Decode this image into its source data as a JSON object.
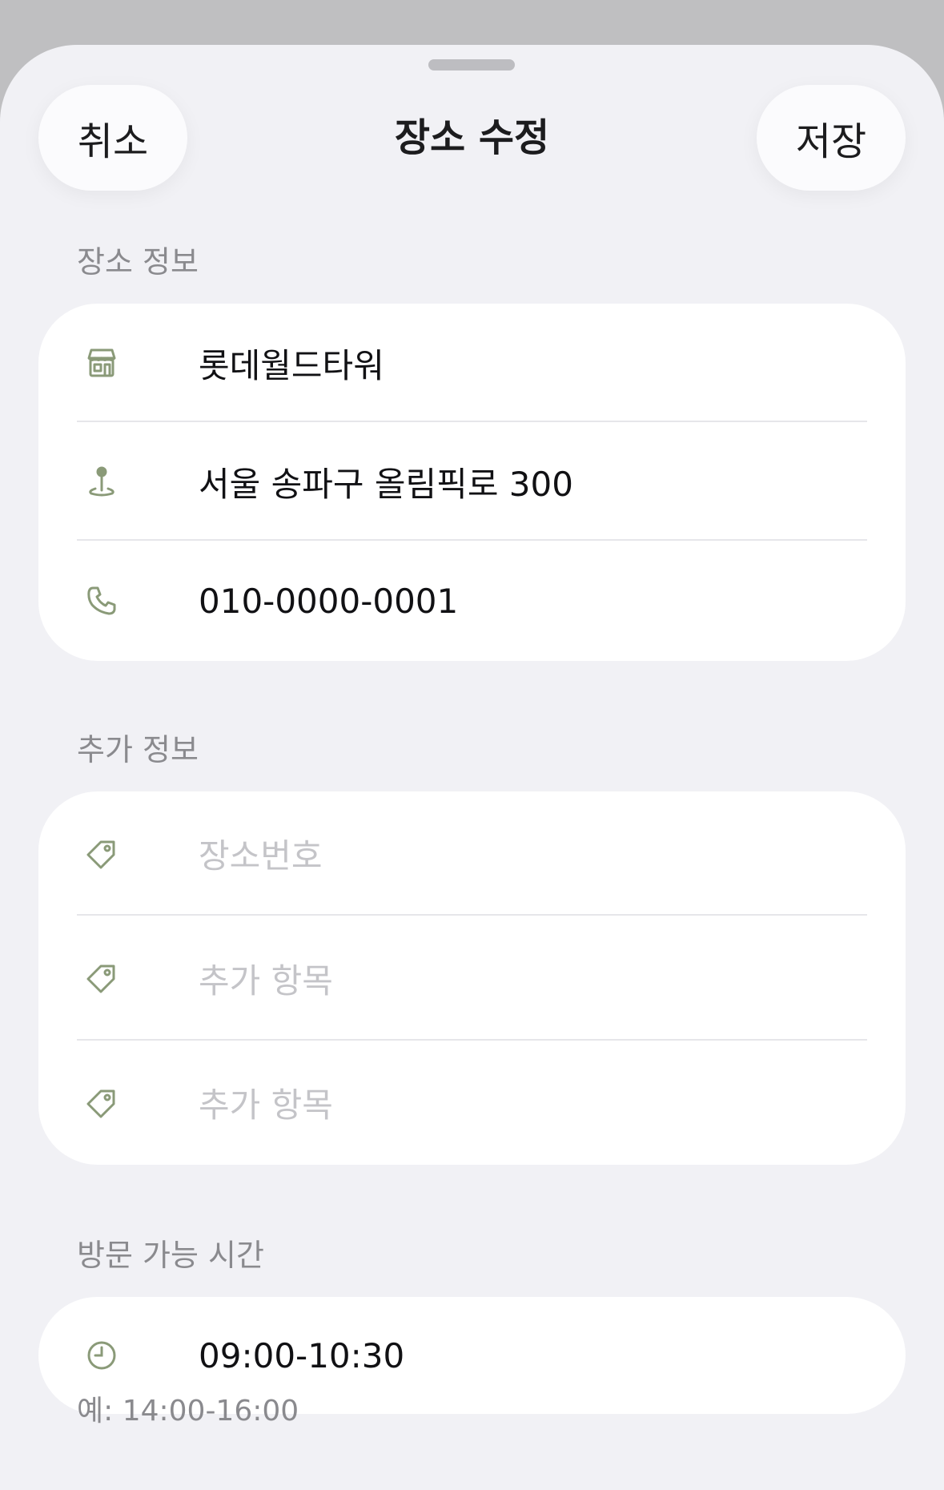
{
  "header": {
    "cancel_label": "취소",
    "title": "장소 수정",
    "save_label": "저장"
  },
  "place_info": {
    "section_title": "장소 정보",
    "name": "롯데월드타워",
    "address": "서울 송파구 올림픽로 300",
    "phone": "010-0000-0001",
    "icons": [
      "store-icon",
      "map-pin-icon",
      "phone-icon"
    ]
  },
  "extra_info": {
    "section_title": "추가 정보",
    "fields": [
      {
        "placeholder": "장소번호"
      },
      {
        "placeholder": "추가 항목"
      },
      {
        "placeholder": "추가 항목"
      }
    ],
    "icon": "tag-icon"
  },
  "visit_time": {
    "section_title": "방문 가능 시간",
    "value": "09:00-10:30",
    "hint": "예: 14:00-16:00",
    "icon": "clock-icon"
  },
  "colors": {
    "icon_accent": "#8a9a78",
    "background": "#f1f1f5",
    "card": "#ffffff",
    "placeholder": "#c4c4c8",
    "secondary_text": "#8a8a8e"
  }
}
